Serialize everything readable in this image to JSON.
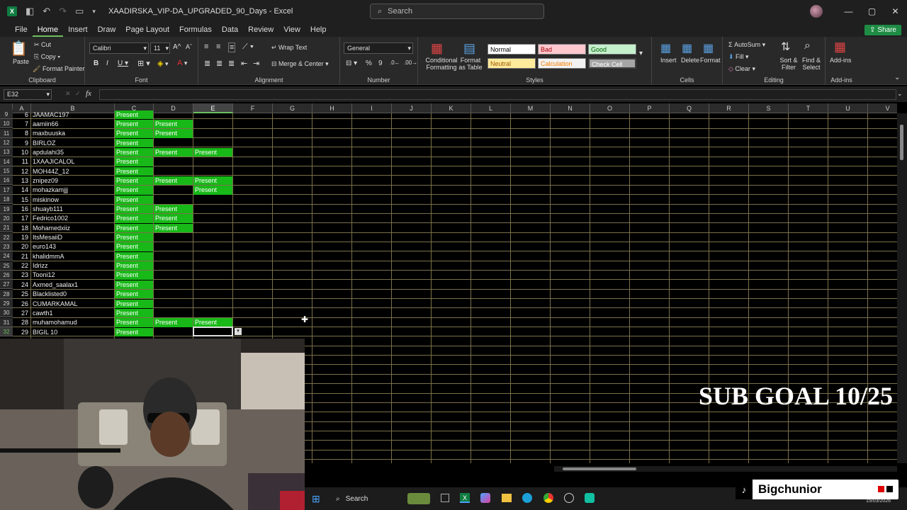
{
  "window": {
    "title": "XAADIRSKA_VIP-DA_UPGRADED_90_Days",
    "app": "Excel",
    "search_placeholder": "Search"
  },
  "tabs": [
    "File",
    "Home",
    "Insert",
    "Draw",
    "Page Layout",
    "Formulas",
    "Data",
    "Review",
    "View",
    "Help"
  ],
  "active_tab": "Home",
  "share_label": "Share",
  "ribbon": {
    "clipboard": {
      "paste": "Paste",
      "cut": "Cut",
      "copy": "Copy",
      "format_painter": "Format Painter",
      "label": "Clipboard"
    },
    "font": {
      "name": "Calibri",
      "size": "11",
      "label": "Font"
    },
    "alignment": {
      "wrap_text": "Wrap Text",
      "merge_center": "Merge & Center",
      "label": "Alignment"
    },
    "number": {
      "format": "General",
      "label": "Number"
    },
    "styles": {
      "conditional": "Conditional Formatting",
      "format_table": "Format as Table",
      "normal": "Normal",
      "bad": "Bad",
      "good": "Good",
      "neutral": "Neutral",
      "calculation": "Calculation",
      "check_cell": "Check Cell",
      "label": "Styles"
    },
    "cells": {
      "insert": "Insert",
      "delete": "Delete",
      "format": "Format",
      "label": "Cells"
    },
    "editing": {
      "autosum": "AutoSum",
      "fill": "Fill",
      "clear": "Clear",
      "sort_filter": "Sort & Filter",
      "find_select": "Find & Select",
      "label": "Editing"
    },
    "addins": {
      "label": "Add-ins",
      "btn": "Add-ins"
    }
  },
  "namebox": "E32",
  "columns": [
    "A",
    "B",
    "C",
    "D",
    "E",
    "F",
    "G",
    "H",
    "I",
    "J",
    "K",
    "L",
    "M",
    "N",
    "O",
    "P",
    "Q",
    "R",
    "S",
    "T",
    "U",
    "V"
  ],
  "selected_column": "E",
  "rows": [
    {
      "r": "9",
      "a": "6",
      "b": "JAAMAC197",
      "c": "Present",
      "d": "",
      "e": ""
    },
    {
      "r": "10",
      "a": "7",
      "b": "aamiin66",
      "c": "Present",
      "d": "Present",
      "e": ""
    },
    {
      "r": "11",
      "a": "8",
      "b": "maxbuuska",
      "c": "Present",
      "d": "Present",
      "e": ""
    },
    {
      "r": "12",
      "a": "9",
      "b": "BIRLOZ",
      "c": "Present",
      "d": "",
      "e": ""
    },
    {
      "r": "13",
      "a": "10",
      "b": "apdulahi35",
      "c": "Present",
      "d": "Present",
      "e": "Present"
    },
    {
      "r": "14",
      "a": "11",
      "b": "1XAAJICALOL",
      "c": "Present",
      "d": "",
      "e": ""
    },
    {
      "r": "15",
      "a": "12",
      "b": "MOH44Z_12",
      "c": "Present",
      "d": "",
      "e": ""
    },
    {
      "r": "16",
      "a": "13",
      "b": "znipez09",
      "c": "Present",
      "d": "Present",
      "e": "Present"
    },
    {
      "r": "17",
      "a": "14",
      "b": "mohazkamjjj",
      "c": "Present",
      "d": "",
      "e": "Present"
    },
    {
      "r": "18",
      "a": "15",
      "b": "miskinow",
      "c": "Present",
      "d": "",
      "e": ""
    },
    {
      "r": "19",
      "a": "16",
      "b": "shuayb111",
      "c": "Present",
      "d": "Present",
      "e": ""
    },
    {
      "r": "20",
      "a": "17",
      "b": "Fedrico1002",
      "c": "Present",
      "d": "Present",
      "e": ""
    },
    {
      "r": "21",
      "a": "18",
      "b": "Mohamedxiiz",
      "c": "Present",
      "d": "Present",
      "e": ""
    },
    {
      "r": "22",
      "a": "19",
      "b": "ItsMesaiiD",
      "c": "Present",
      "d": "",
      "e": ""
    },
    {
      "r": "23",
      "a": "20",
      "b": "euro143",
      "c": "Present",
      "d": "",
      "e": ""
    },
    {
      "r": "24",
      "a": "21",
      "b": "khalidmmA",
      "c": "Present",
      "d": "",
      "e": ""
    },
    {
      "r": "25",
      "a": "22",
      "b": "Idrizz",
      "c": "Present",
      "d": "",
      "e": ""
    },
    {
      "r": "26",
      "a": "23",
      "b": "Tooni12",
      "c": "Present",
      "d": "",
      "e": ""
    },
    {
      "r": "27",
      "a": "24",
      "b": "Axmed_saalax1",
      "c": "Present",
      "d": "",
      "e": ""
    },
    {
      "r": "28",
      "a": "25",
      "b": "Blacklisted0",
      "c": "Present",
      "d": "",
      "e": ""
    },
    {
      "r": "29",
      "a": "26",
      "b": "CUMARKAMAL",
      "c": "Present",
      "d": "",
      "e": ""
    },
    {
      "r": "30",
      "a": "27",
      "b": "cawth1",
      "c": "Present",
      "d": "",
      "e": ""
    },
    {
      "r": "31",
      "a": "28",
      "b": "muhamohamud",
      "c": "Present",
      "d": "Present",
      "e": "Present"
    },
    {
      "r": "32",
      "a": "29",
      "b": "BIGIL 10",
      "c": "Present",
      "d": "",
      "e": ""
    }
  ],
  "overlay": {
    "sub_goal": "SUB GOAL 10/25",
    "tiktok_name": "Bigchunior"
  },
  "taskbar": {
    "search": "Search",
    "date": "15/03/2026"
  }
}
